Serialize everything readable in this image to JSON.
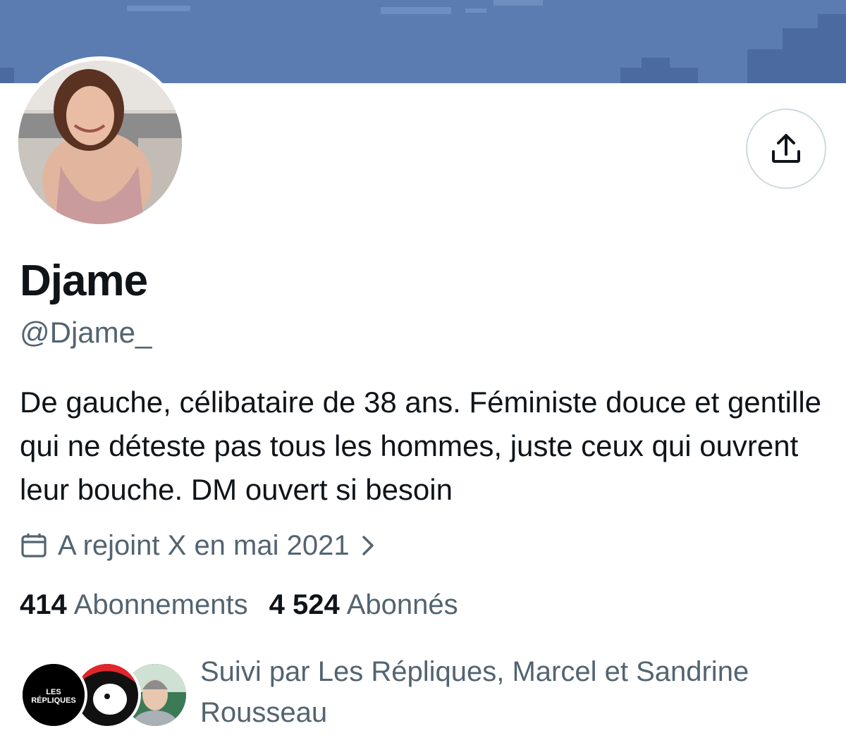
{
  "profile": {
    "display_name": "Djame",
    "handle": "@Djame_",
    "bio": "De gauche, célibataire de 38 ans. Féministe douce et gentille qui ne déteste pas tous les hommes, juste ceux qui ouvrent leur bouche. DM ouvert si besoin",
    "joined": "A rejoint X en mai 2021",
    "joined_icon": "calendar-icon",
    "following_count": "414",
    "following_label": "Abonnements",
    "followers_count": "4 524",
    "followers_label": "Abonnés",
    "followed_by": "Suivi par Les Répliques, Marcel et Sandrine Rousseau",
    "follower_avatar_1_text": "LES RÉPLIQUES"
  },
  "actions": {
    "share_icon": "share-icon"
  },
  "colors": {
    "banner": "#5b7cb0",
    "text_primary": "#0f1419",
    "text_secondary": "#536471",
    "border": "#cfd9de"
  }
}
